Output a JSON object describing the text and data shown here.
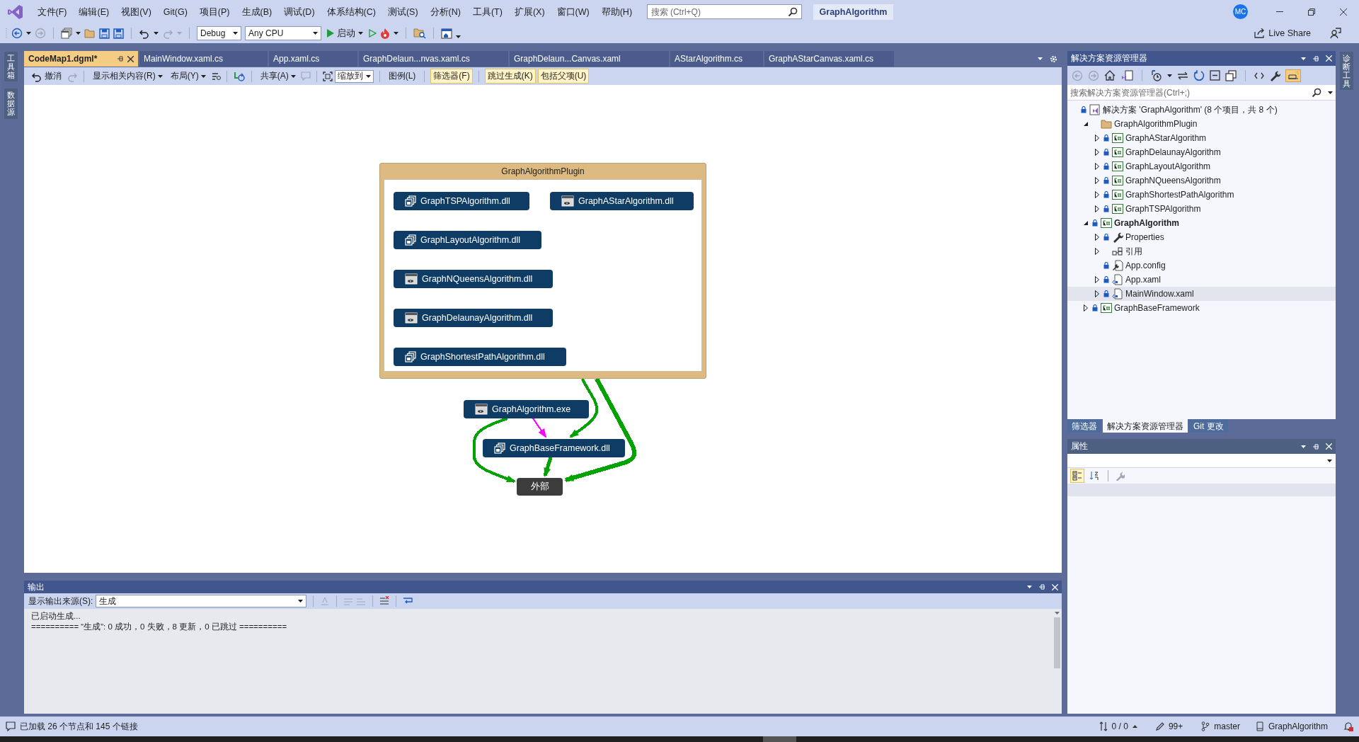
{
  "menu": {
    "items": [
      "文件(F)",
      "编辑(E)",
      "视图(V)",
      "Git(G)",
      "项目(P)",
      "生成(B)",
      "调试(D)",
      "体系结构(C)",
      "测试(S)",
      "分析(N)",
      "工具(T)",
      "扩展(X)",
      "窗口(W)",
      "帮助(H)"
    ],
    "search": {
      "placeholder": "搜索 (Ctrl+Q)"
    },
    "solution_name": "GraphAlgorithm",
    "account_initials": "MC"
  },
  "toolbar": {
    "configuration": "Debug",
    "platform": "Any CPU",
    "start_label": "启动",
    "live_share": "Live Share"
  },
  "left_strip": [
    "工具箱",
    "数据源"
  ],
  "right_strip": [
    "诊断工具"
  ],
  "document_tabs": [
    {
      "label": "CodeMap1.dgml*",
      "selected": true
    },
    {
      "label": "MainWindow.xaml.cs",
      "selected": false
    },
    {
      "label": "App.xaml.cs",
      "selected": false
    },
    {
      "label": "GraphDelaun...nvas.xaml.cs",
      "selected": false
    },
    {
      "label": "GraphDelaun...Canvas.xaml",
      "selected": false
    },
    {
      "label": "AStarAlgorithm.cs",
      "selected": false
    },
    {
      "label": "GraphAStarCanvas.xaml.cs",
      "selected": false
    }
  ],
  "codemap_toolbar": {
    "undo": "撤消",
    "related": "显示相关内容(R)",
    "layout": "布局(Y)",
    "share": "共享(A)",
    "zoom": "缩放到",
    "toggles": [
      {
        "label": "图例(L)",
        "checked": false
      },
      {
        "label": "筛选器(F)",
        "checked": true
      },
      {
        "label": "跳过生成(K)",
        "checked": true
      },
      {
        "label": "包括父项(U)",
        "checked": true
      }
    ]
  },
  "code_map": {
    "group": {
      "label": "GraphAlgorithmPlugin",
      "nodes": [
        {
          "label": "GraphTSPAlgorithm.dll",
          "kind": "library"
        },
        {
          "label": "GraphAStarAlgorithm.dll",
          "kind": "application"
        },
        {
          "label": "GraphLayoutAlgorithm.dll",
          "kind": "library"
        },
        {
          "label": "GraphNQueensAlgorithm.dll",
          "kind": "application"
        },
        {
          "label": "GraphDelaunayAlgorithm.dll",
          "kind": "application"
        },
        {
          "label": "GraphShortestPathAlgorithm.dll",
          "kind": "library"
        }
      ]
    },
    "nodes": [
      {
        "label": "GraphAlgorithm.exe",
        "kind": "application"
      },
      {
        "label": "GraphBaseFramework.dll",
        "kind": "library"
      },
      {
        "label": "外部",
        "kind": "external"
      }
    ],
    "links": [
      {
        "color": "#00a300"
      },
      {
        "color": "#00a300"
      },
      {
        "color": "#00a300"
      },
      {
        "color": "#00a300"
      },
      {
        "color": "#ff00ff"
      }
    ]
  },
  "output": {
    "title": "输出",
    "source_label": "显示输出来源(S):",
    "source": "生成",
    "lines": [
      "已启动生成...",
      "========== “生成”: 0 成功，0 失败，8 更新，0 已跳过 =========="
    ]
  },
  "explorer": {
    "title": "解决方案资源管理器",
    "search": {
      "placeholder": "搜索解决方案资源管理器(Ctrl+;)"
    },
    "tree": [
      {
        "label": "解决方案 'GraphAlgorithm' (8 个项目，共 8 个)",
        "kind": "solution",
        "locked": true,
        "startup": false,
        "selected": false,
        "children": [
          {
            "label": "GraphAlgorithmPlugin",
            "kind": "folder",
            "locked": false,
            "startup": false,
            "expanded": true,
            "selected": false,
            "children": [
              {
                "label": "GraphAStarAlgorithm",
                "kind": "project",
                "locked": true,
                "startup": false,
                "expanded": false,
                "selected": false
              },
              {
                "label": "GraphDelaunayAlgorithm",
                "kind": "project",
                "locked": true,
                "startup": false,
                "expanded": false,
                "selected": false
              },
              {
                "label": "GraphLayoutAlgorithm",
                "kind": "project",
                "locked": true,
                "startup": false,
                "expanded": false,
                "selected": false
              },
              {
                "label": "GraphNQueensAlgorithm",
                "kind": "project",
                "locked": true,
                "startup": false,
                "expanded": false,
                "selected": false
              },
              {
                "label": "GraphShortestPathAlgorithm",
                "kind": "project",
                "locked": true,
                "startup": false,
                "expanded": false,
                "selected": false
              },
              {
                "label": "GraphTSPAlgorithm",
                "kind": "project",
                "locked": true,
                "startup": false,
                "expanded": false,
                "selected": false
              }
            ]
          },
          {
            "label": "GraphAlgorithm",
            "kind": "project",
            "locked": true,
            "startup": true,
            "expanded": true,
            "selected": false,
            "children": [
              {
                "label": "Properties",
                "kind": "properties",
                "locked": true,
                "startup": false,
                "expanded": false,
                "selected": false
              },
              {
                "label": "引用",
                "kind": "references",
                "locked": false,
                "startup": false,
                "expanded": false,
                "selected": false
              },
              {
                "label": "App.config",
                "kind": "config",
                "locked": true,
                "startup": false,
                "selected": false
              },
              {
                "label": "App.xaml",
                "kind": "xaml",
                "locked": true,
                "startup": false,
                "expanded": false,
                "selected": false
              },
              {
                "label": "MainWindow.xaml",
                "kind": "xaml",
                "locked": true,
                "startup": false,
                "expanded": false,
                "selected": true
              }
            ]
          },
          {
            "label": "GraphBaseFramework",
            "kind": "project",
            "locked": true,
            "startup": false,
            "expanded": false,
            "selected": false
          }
        ]
      }
    ],
    "tabs": [
      {
        "label": "筛选器",
        "selected": false
      },
      {
        "label": "解决方案资源管理器",
        "selected": true
      },
      {
        "label": "Git 更改",
        "selected": false
      }
    ]
  },
  "properties": {
    "title": "属性",
    "view_buttons": [
      {
        "selected": true
      },
      {
        "selected": false
      }
    ]
  },
  "status_bar": {
    "message": "已加载 26 个节点和 145 个链接",
    "changes": "0 / 0",
    "edits": "99+",
    "branch": "master",
    "repository": "GraphAlgorithm"
  }
}
